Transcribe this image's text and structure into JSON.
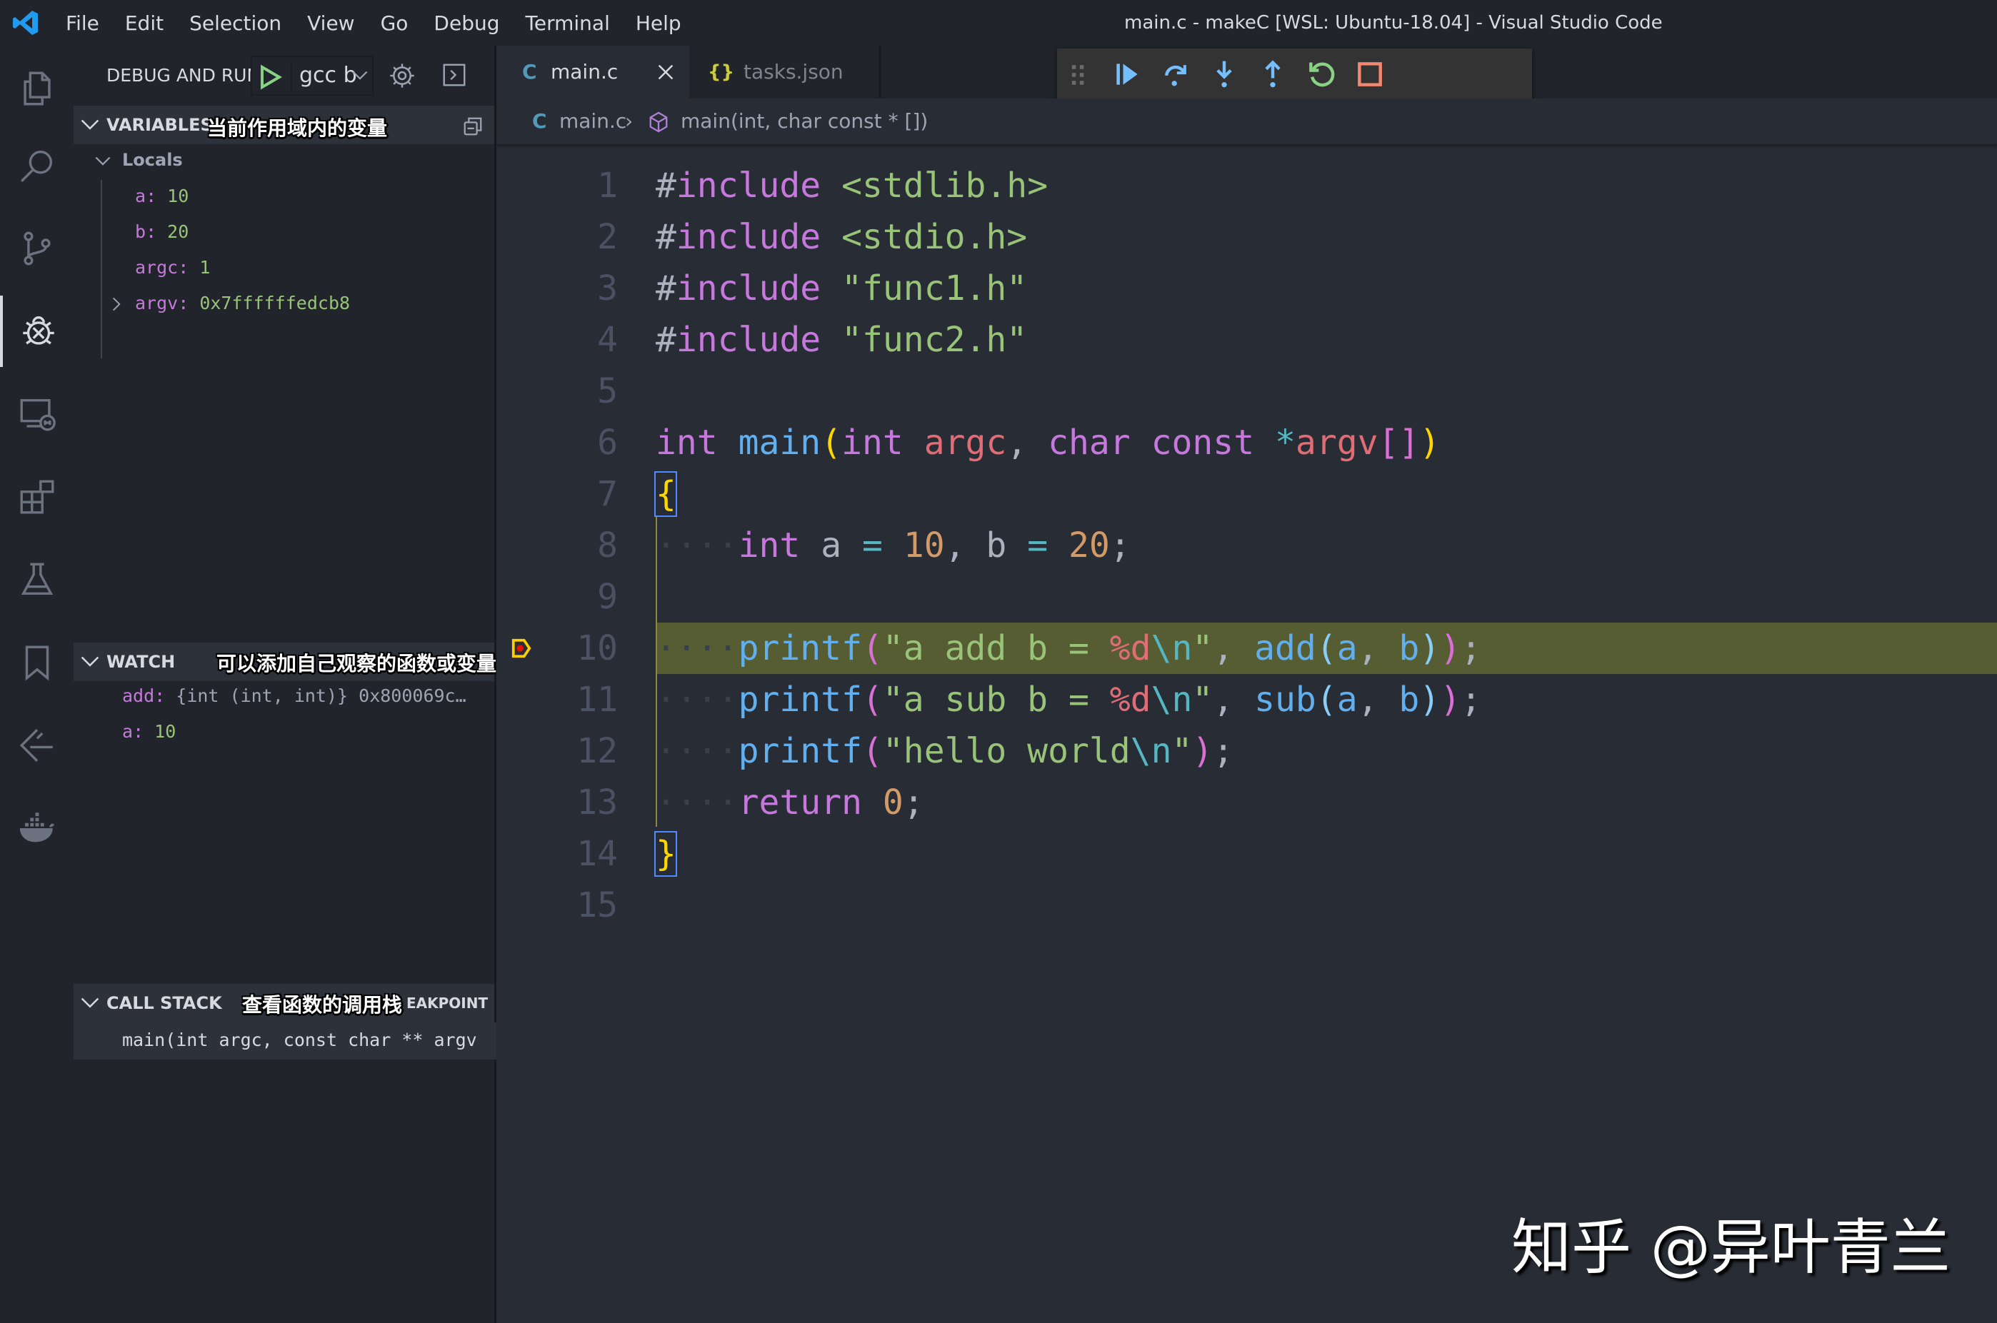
{
  "titlebar": {
    "menu": [
      "File",
      "Edit",
      "Selection",
      "View",
      "Go",
      "Debug",
      "Terminal",
      "Help"
    ],
    "window_title": "main.c - makeC [WSL: Ubuntu-18.04] - Visual Studio Code"
  },
  "activity_bar": {
    "items": [
      "explorer-icon",
      "search-icon",
      "source-control-icon",
      "debug-icon",
      "remote-explorer-icon",
      "extensions-icon",
      "testing-icon",
      "bookmarks-icon",
      "git-graph-icon",
      "docker-icon"
    ],
    "active": "debug-icon"
  },
  "sidebar": {
    "title": "DEBUG AND RUN",
    "config_name": "gcc b",
    "variables": {
      "header": "VARIABLES",
      "annotation": "当前作用域内的变量",
      "scope": "Locals",
      "items": [
        {
          "name": "a",
          "value": "10",
          "expandable": false
        },
        {
          "name": "b",
          "value": "20",
          "expandable": false
        },
        {
          "name": "argc",
          "value": "1",
          "expandable": false
        },
        {
          "name": "argv",
          "value": "0x7ffffffedcb8",
          "expandable": true
        }
      ]
    },
    "watch": {
      "header": "WATCH",
      "annotation": "可以添加自己观察的函数或变量",
      "items": [
        {
          "name": "add",
          "value": "{int (int, int)} 0x800069c…"
        },
        {
          "name": "a",
          "value": "10"
        }
      ]
    },
    "call_stack": {
      "header": "CALL STACK",
      "annotation": "查看函数的调用栈",
      "overflow_text": "EAKPOINT",
      "frames": [
        "main(int argc, const char ** argv"
      ]
    }
  },
  "editor": {
    "tabs": [
      {
        "icon": "C",
        "label": "main.c",
        "active": true
      },
      {
        "icon": "{}",
        "label": "tasks.json",
        "active": false
      }
    ],
    "breadcrumb": {
      "file": "main.c",
      "symbol": "main(int, char const * [])"
    },
    "debug_toolbar": [
      "drag-handle",
      "continue",
      "step-over",
      "step-into",
      "step-out",
      "restart",
      "stop"
    ],
    "current_line": 10,
    "lines": [
      {
        "n": "1",
        "tokens": [
          [
            "c-pre",
            "#"
          ],
          [
            "c-kw",
            "include"
          ],
          [
            "c-pun",
            " "
          ],
          [
            "c-str",
            "<stdlib.h>"
          ]
        ]
      },
      {
        "n": "2",
        "tokens": [
          [
            "c-pre",
            "#"
          ],
          [
            "c-kw",
            "include"
          ],
          [
            "c-pun",
            " "
          ],
          [
            "c-str",
            "<stdio.h>"
          ]
        ]
      },
      {
        "n": "3",
        "tokens": [
          [
            "c-pre",
            "#"
          ],
          [
            "c-kw",
            "include"
          ],
          [
            "c-pun",
            " "
          ],
          [
            "c-str",
            "\"func1.h\""
          ]
        ]
      },
      {
        "n": "4",
        "tokens": [
          [
            "c-pre",
            "#"
          ],
          [
            "c-kw",
            "include"
          ],
          [
            "c-pun",
            " "
          ],
          [
            "c-str",
            "\"func2.h\""
          ]
        ]
      },
      {
        "n": "5",
        "tokens": []
      },
      {
        "n": "6",
        "tokens": [
          [
            "c-kw",
            "int"
          ],
          [
            "c-pun",
            " "
          ],
          [
            "c-fn",
            "main"
          ],
          [
            "c-br1",
            "("
          ],
          [
            "c-kw",
            "int"
          ],
          [
            "c-pun",
            " "
          ],
          [
            "c-par",
            "argc"
          ],
          [
            "c-pun",
            ", "
          ],
          [
            "c-kw",
            "char"
          ],
          [
            "c-pun",
            " "
          ],
          [
            "c-kw",
            "const"
          ],
          [
            "c-pun",
            " "
          ],
          [
            "c-op",
            "*"
          ],
          [
            "c-par",
            "argv"
          ],
          [
            "c-br2",
            "[]"
          ],
          [
            "c-br1",
            ")"
          ]
        ]
      },
      {
        "n": "7",
        "tokens": [
          [
            "c-br1",
            "{"
          ]
        ]
      },
      {
        "n": "8",
        "tokens": [
          [
            "ws",
            "····"
          ],
          [
            "c-kw",
            "int"
          ],
          [
            "c-pun",
            " a "
          ],
          [
            "c-op",
            "="
          ],
          [
            "c-pun",
            " "
          ],
          [
            "c-num",
            "10"
          ],
          [
            "c-pun",
            ", b "
          ],
          [
            "c-op",
            "="
          ],
          [
            "c-pun",
            " "
          ],
          [
            "c-num",
            "20"
          ],
          [
            "c-pun",
            ";"
          ]
        ]
      },
      {
        "n": "9",
        "tokens": []
      },
      {
        "n": "10",
        "tokens": [
          [
            "ws",
            "····"
          ],
          [
            "c-fn",
            "printf"
          ],
          [
            "c-br2",
            "("
          ],
          [
            "c-str",
            "\"a add b = "
          ],
          [
            "c-fmt",
            "%d"
          ],
          [
            "c-esc",
            "\\n"
          ],
          [
            "c-str",
            "\""
          ],
          [
            "c-pun",
            ", "
          ],
          [
            "c-fn",
            "add"
          ],
          [
            "c-br3",
            "("
          ],
          [
            "c-fn",
            "a"
          ],
          [
            "c-pun",
            ", "
          ],
          [
            "c-fn",
            "b"
          ],
          [
            "c-br3",
            ")"
          ],
          [
            "c-br2",
            ")"
          ],
          [
            "c-pun",
            ";"
          ]
        ]
      },
      {
        "n": "11",
        "tokens": [
          [
            "ws",
            "····"
          ],
          [
            "c-fn",
            "printf"
          ],
          [
            "c-br2",
            "("
          ],
          [
            "c-str",
            "\"a sub b = "
          ],
          [
            "c-fmt",
            "%d"
          ],
          [
            "c-esc",
            "\\n"
          ],
          [
            "c-str",
            "\""
          ],
          [
            "c-pun",
            ", "
          ],
          [
            "c-fn",
            "sub"
          ],
          [
            "c-br3",
            "("
          ],
          [
            "c-fn",
            "a"
          ],
          [
            "c-pun",
            ", "
          ],
          [
            "c-fn",
            "b"
          ],
          [
            "c-br3",
            ")"
          ],
          [
            "c-br2",
            ")"
          ],
          [
            "c-pun",
            ";"
          ]
        ]
      },
      {
        "n": "12",
        "tokens": [
          [
            "ws",
            "····"
          ],
          [
            "c-fn",
            "printf"
          ],
          [
            "c-br2",
            "("
          ],
          [
            "c-str",
            "\"hello world"
          ],
          [
            "c-esc",
            "\\n"
          ],
          [
            "c-str",
            "\""
          ],
          [
            "c-br2",
            ")"
          ],
          [
            "c-pun",
            ";"
          ]
        ]
      },
      {
        "n": "13",
        "tokens": [
          [
            "ws",
            "····"
          ],
          [
            "c-kw",
            "return"
          ],
          [
            "c-pun",
            " "
          ],
          [
            "c-num",
            "0"
          ],
          [
            "c-pun",
            ";"
          ]
        ]
      },
      {
        "n": "14",
        "tokens": [
          [
            "c-br1",
            "}"
          ]
        ]
      },
      {
        "n": "15",
        "tokens": []
      }
    ]
  },
  "watermark": "知乎 @异叶青兰",
  "colors": {
    "highlight_line": "#575d33",
    "accent_blue": "#75beff",
    "restart_green": "#89d185",
    "stop_red": "#f48771"
  }
}
